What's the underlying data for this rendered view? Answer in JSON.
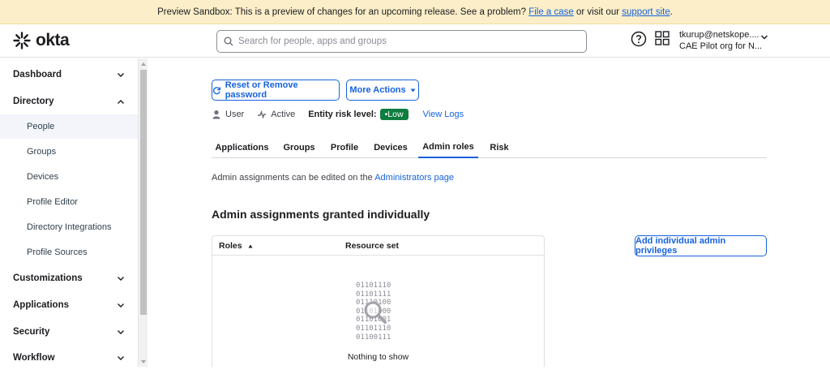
{
  "banner": {
    "prefix": "Preview Sandbox: This is a preview of changes for an upcoming release. See a problem?",
    "link1": "File a case",
    "middle": "or visit our",
    "link2": "support site",
    "suffix": "."
  },
  "header": {
    "logo": "okta",
    "search_placeholder": "Search for people, apps and groups",
    "user_email": "tkurup@netskope....",
    "org_name": "CAE Pilot org for N..."
  },
  "sidebar": {
    "sections": [
      {
        "label": "Dashboard"
      },
      {
        "label": "Directory"
      },
      {
        "label": "Customizations"
      },
      {
        "label": "Applications"
      },
      {
        "label": "Security"
      },
      {
        "label": "Workflow"
      }
    ],
    "directory_items": [
      {
        "label": "People"
      },
      {
        "label": "Groups"
      },
      {
        "label": "Devices"
      },
      {
        "label": "Profile Editor"
      },
      {
        "label": "Directory Integrations"
      },
      {
        "label": "Profile Sources"
      }
    ]
  },
  "actions": {
    "reset_label": "Reset or Remove password",
    "more_label": "More Actions"
  },
  "meta": {
    "type": "User",
    "status": "Active",
    "risk_label": "Entity risk level:",
    "risk_value": "Low",
    "view_logs": "View Logs"
  },
  "tabs": [
    {
      "label": "Applications"
    },
    {
      "label": "Groups"
    },
    {
      "label": "Profile"
    },
    {
      "label": "Devices"
    },
    {
      "label": "Admin roles"
    },
    {
      "label": "Risk"
    }
  ],
  "admin": {
    "info_prefix": "Admin assignments can be edited on the",
    "info_link": "Administrators page",
    "section_title": "Admin assignments granted individually",
    "add_button": "Add individual admin privileges",
    "col_roles": "Roles",
    "col_resource": "Resource set",
    "binary": [
      "01101110",
      "01101111",
      "01110100",
      "01101000",
      "01101001",
      "01101110",
      "01100111"
    ],
    "empty_text": "Nothing to show"
  },
  "colors": {
    "accent": "#1662dd",
    "banner_bg": "#fbeec8",
    "risk_low": "#0f7d40"
  }
}
